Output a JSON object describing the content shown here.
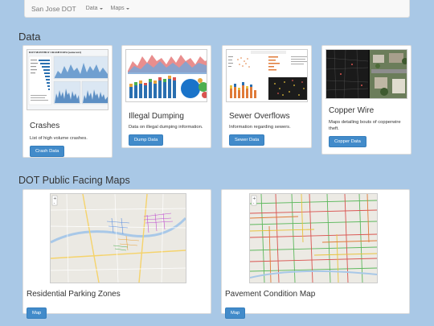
{
  "navbar": {
    "brand": "San Jose DOT",
    "items": [
      {
        "label": "Data"
      },
      {
        "label": "Maps"
      }
    ]
  },
  "sections": {
    "data_title": "Data",
    "maps_title": "DOT Public Facing Maps"
  },
  "data_cards": [
    {
      "title": "Crashes",
      "description": "List of high volume crashes.",
      "button": "Crash Data",
      "thumb_heading": "DOT MONTHLY CRASH DATA (some text)"
    },
    {
      "title": "Illegal Dumping",
      "description": "Data on illegal dumping information.",
      "button": "Dump Data"
    },
    {
      "title": "Sewer Overflows",
      "description": "Information regarding sewers.",
      "button": "Sewer Data"
    },
    {
      "title": "Copper Wire",
      "description": "Maps detailing bouts of copperwire theft.",
      "button": "Copper Data"
    }
  ],
  "map_cards": [
    {
      "title": "Residential Parking Zones",
      "button": "Map"
    },
    {
      "title": "Pavement Condition Map",
      "button": "Map"
    }
  ],
  "colors": {
    "background": "#a9c8e6",
    "button": "#428bca",
    "card": "#ffffff"
  }
}
